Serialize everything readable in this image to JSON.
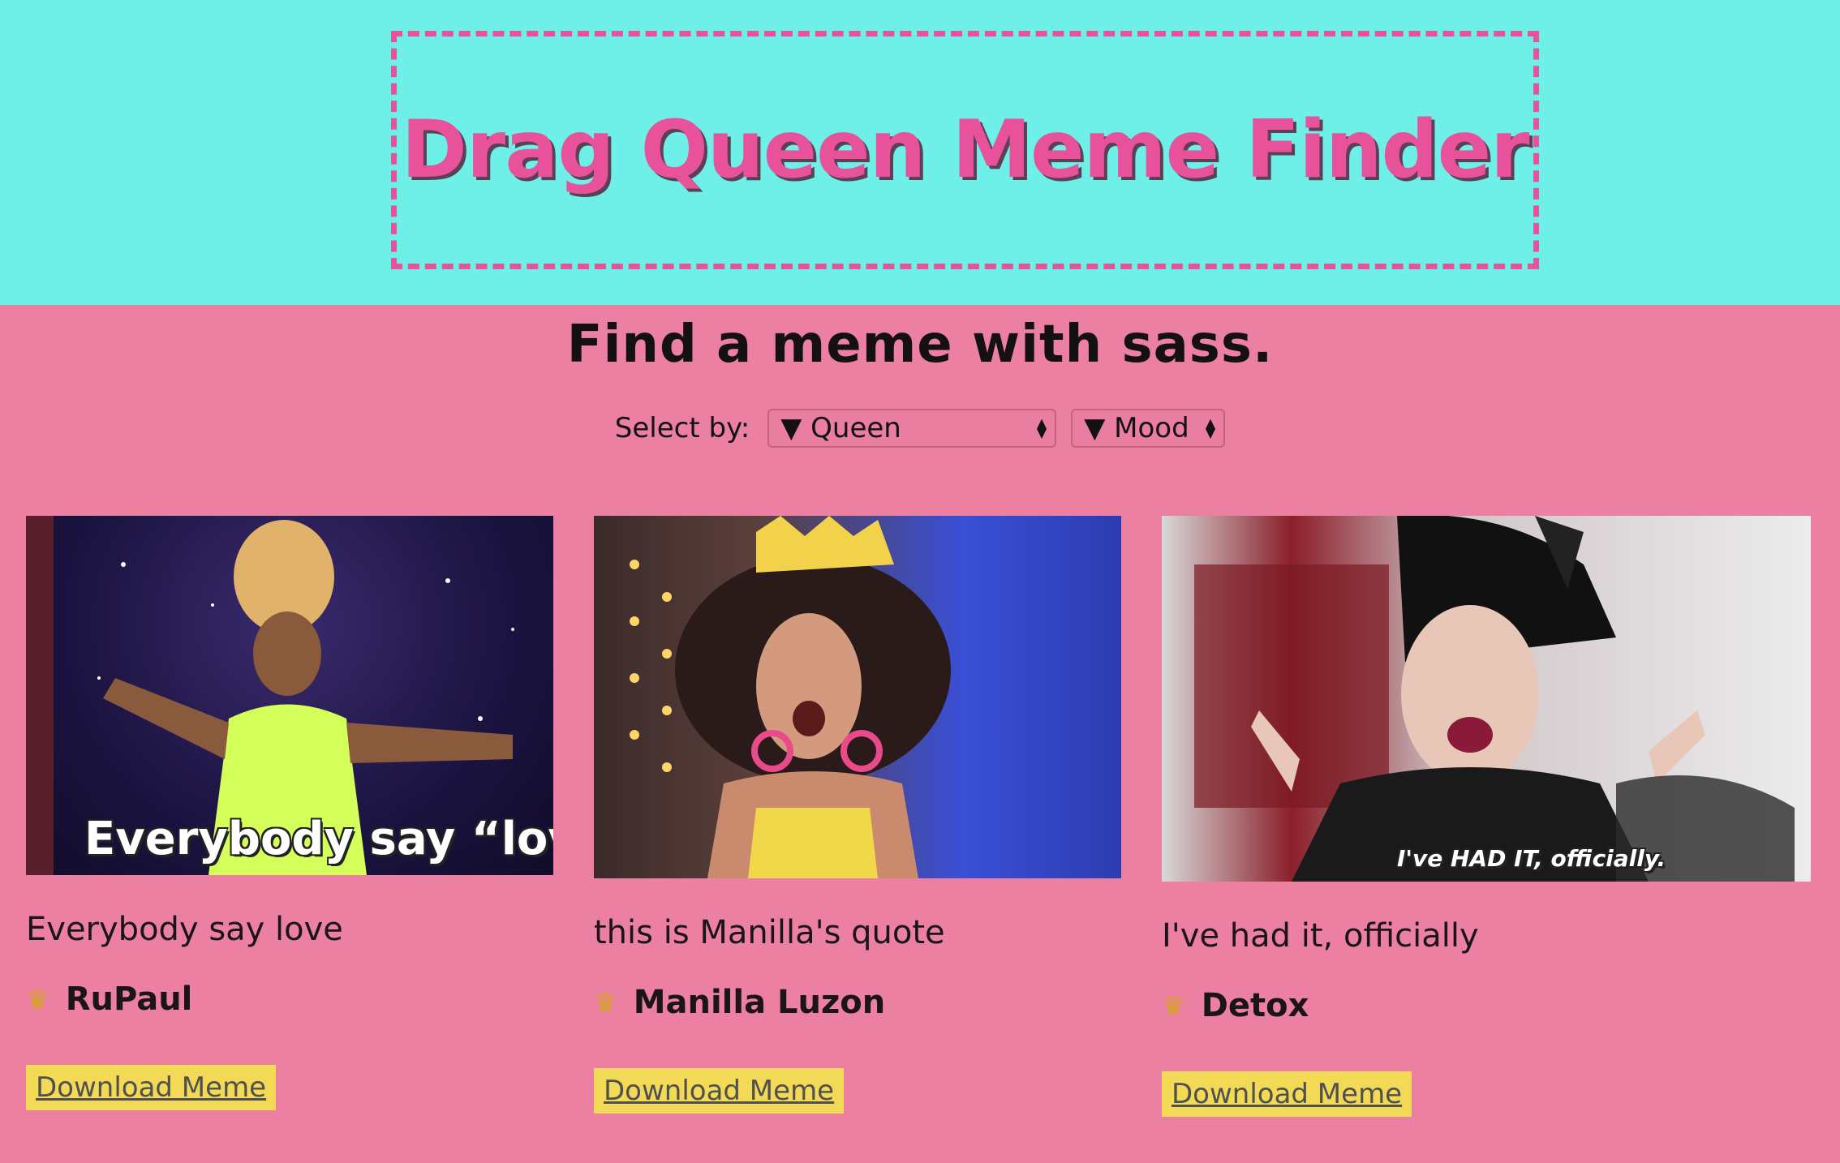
{
  "header": {
    "title": "Drag Queen Meme Finder"
  },
  "subtitle": "Find a meme with sass.",
  "filters": {
    "label": "Select by:",
    "queen": "▼ Queen",
    "mood": "▼ Mood"
  },
  "cards": [
    {
      "overlay": "Everybody say “lov",
      "caption": "Everybody say love",
      "queen": "RuPaul",
      "download": "Download Meme"
    },
    {
      "overlay": "",
      "caption": "this is Manilla's quote",
      "queen": "Manilla Luzon",
      "download": "Download Meme"
    },
    {
      "overlay": "I've HAD IT, officially.",
      "caption": "I've had it, officially",
      "queen": "Detox",
      "download": "Download Meme"
    }
  ],
  "colors": {
    "header_bg": "#6ef0e8",
    "page_bg": "#ec80a3",
    "accent": "#e8529b",
    "button_bg": "#f3da56"
  }
}
